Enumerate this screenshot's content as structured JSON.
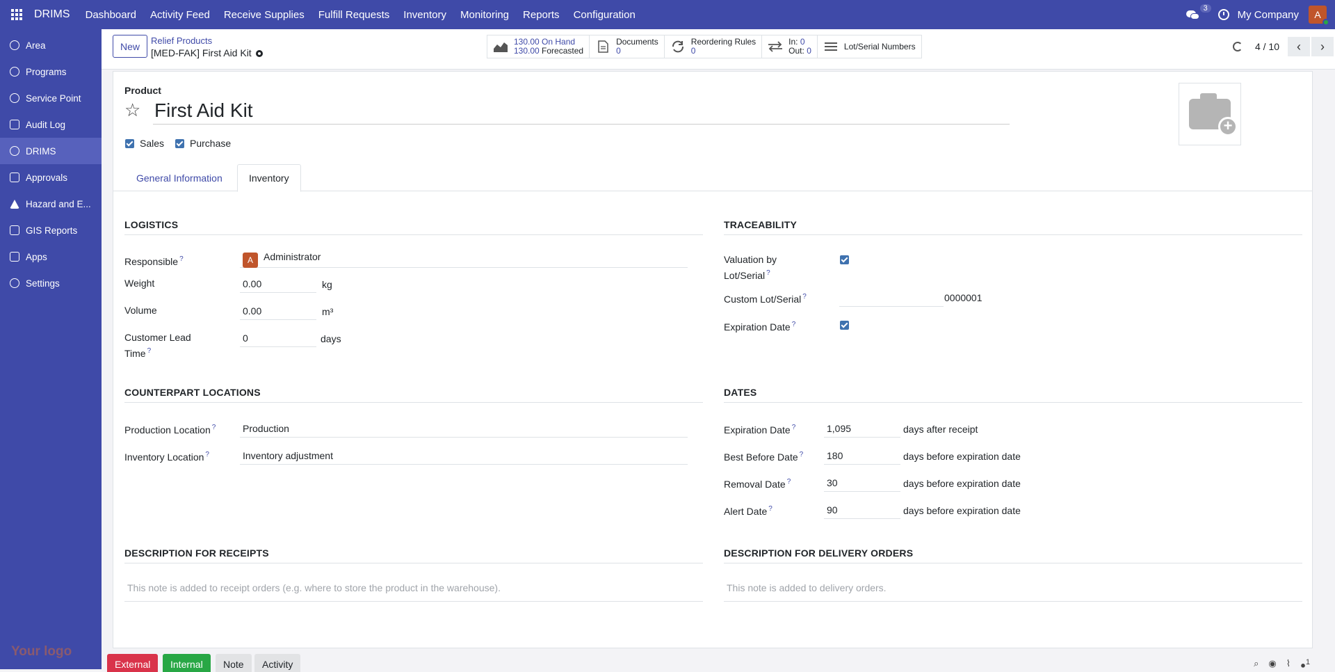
{
  "topbar": {
    "brand": "DRIMS",
    "menu": [
      "Dashboard",
      "Activity Feed",
      "Receive Supplies",
      "Fulfill Requests",
      "Inventory",
      "Monitoring",
      "Reports",
      "Configuration"
    ],
    "messages_count": "3",
    "company": "My Company",
    "avatar_letter": "A"
  },
  "sidebar": {
    "items": [
      {
        "label": "Area",
        "icon": "user-icon"
      },
      {
        "label": "Programs",
        "icon": "gear-icon"
      },
      {
        "label": "Service Point",
        "icon": "user-icon"
      },
      {
        "label": "Audit Log",
        "icon": "chart-icon"
      },
      {
        "label": "DRIMS",
        "icon": "snowflake-icon"
      },
      {
        "label": "Approvals",
        "icon": "approvals-icon"
      },
      {
        "label": "Hazard and E...",
        "icon": "warning-icon"
      },
      {
        "label": "GIS Reports",
        "icon": "report-icon"
      },
      {
        "label": "Apps",
        "icon": "apps-icon"
      },
      {
        "label": "Settings",
        "icon": "gear-icon"
      }
    ],
    "active_index": 4,
    "logo_text": "Your logo"
  },
  "control": {
    "new_label": "New",
    "breadcrumb_parent": "Relief Products",
    "breadcrumb_current": "[MED-FAK] First Aid Kit",
    "stats": {
      "on_hand_value": "130.00",
      "on_hand_label": "On Hand",
      "forecasted_value": "130.00",
      "forecasted_label": "Forecasted",
      "documents_label": "Documents",
      "documents_value": "0",
      "reordering_label": "Reordering Rules",
      "reordering_value": "0",
      "in_label": "In:",
      "in_value": "0",
      "out_label": "Out:",
      "out_value": "0",
      "lot_label": "Lot/Serial Numbers"
    },
    "pager": "4 / 10"
  },
  "form": {
    "product_label": "Product",
    "name": "First Aid Kit",
    "sales_label": "Sales",
    "purchase_label": "Purchase",
    "tabs": [
      "General Information",
      "Inventory"
    ],
    "active_tab": 1,
    "logistics": {
      "title": "LOGISTICS",
      "responsible_label": "Responsible",
      "responsible_value": "Administrator",
      "responsible_avatar": "A",
      "weight_label": "Weight",
      "weight_value": "0.00",
      "weight_unit": "kg",
      "volume_label": "Volume",
      "volume_value": "0.00",
      "volume_unit": "m³",
      "lead_label_1": "Customer Lead",
      "lead_label_2": "Time",
      "lead_value": "0",
      "lead_unit": "days"
    },
    "traceability": {
      "title": "TRACEABILITY",
      "valuation_label_1": "Valuation by",
      "valuation_label_2": "Lot/Serial",
      "custom_lot_label": "Custom Lot/Serial",
      "custom_lot_value": "0000001",
      "expiration_label": "Expiration Date"
    },
    "counterpart": {
      "title": "COUNTERPART LOCATIONS",
      "production_label": "Production Location",
      "production_value": "Production",
      "inventory_label": "Inventory Location",
      "inventory_value": "Inventory adjustment"
    },
    "dates": {
      "title": "DATES",
      "rows": [
        {
          "label": "Expiration Date",
          "value": "1,095",
          "unit": "days after receipt"
        },
        {
          "label": "Best Before Date",
          "value": "180",
          "unit": "days before expiration date"
        },
        {
          "label": "Removal Date",
          "value": "30",
          "unit": "days before expiration date"
        },
        {
          "label": "Alert Date",
          "value": "90",
          "unit": "days before expiration date"
        }
      ]
    },
    "receipts": {
      "title": "DESCRIPTION FOR RECEIPTS",
      "placeholder": "This note is added to receipt orders (e.g. where to store the product in the warehouse)."
    },
    "delivery": {
      "title": "DESCRIPTION FOR DELIVERY ORDERS",
      "placeholder": "This note is added to delivery orders."
    }
  },
  "chatter": {
    "external": "External",
    "internal": "Internal",
    "note": "Note",
    "activity": "Activity",
    "followers": "1",
    "colors": {
      "external": "#d9334a",
      "internal": "#28a745"
    }
  }
}
